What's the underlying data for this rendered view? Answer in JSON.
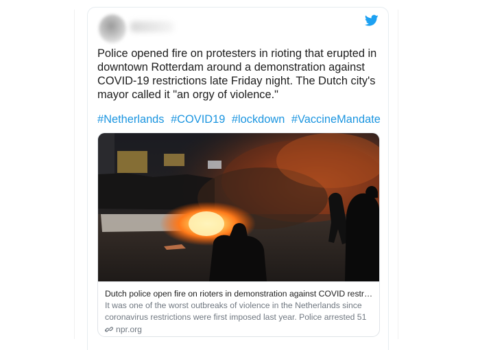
{
  "tweet": {
    "text": "Police opened fire on protesters in rioting that erupted in downtown Rotterdam around a demonstration against COVID-19 restrictions late Friday night. The Dutch city's mayor called it \"an orgy of violence.\"",
    "hashtags": [
      "#Netherlands",
      "#COVID19",
      "#lockdown",
      "#VaccineMandate"
    ]
  },
  "icons": {
    "brand": "twitter-bird-icon",
    "link": "link-icon"
  },
  "link_card": {
    "title": "Dutch police open fire on rioters in demonstration against COVID restric...",
    "description": "It was one of the worst outbreaks of violence in the Netherlands since coronavirus restrictions were first imposed last year. Police arrested 51 ...",
    "domain": "npr.org"
  },
  "colors": {
    "hashtag": "#1b95e0",
    "twitter_blue": "#1da1f2",
    "text": "#1c1c1c",
    "muted": "#6f7780"
  }
}
